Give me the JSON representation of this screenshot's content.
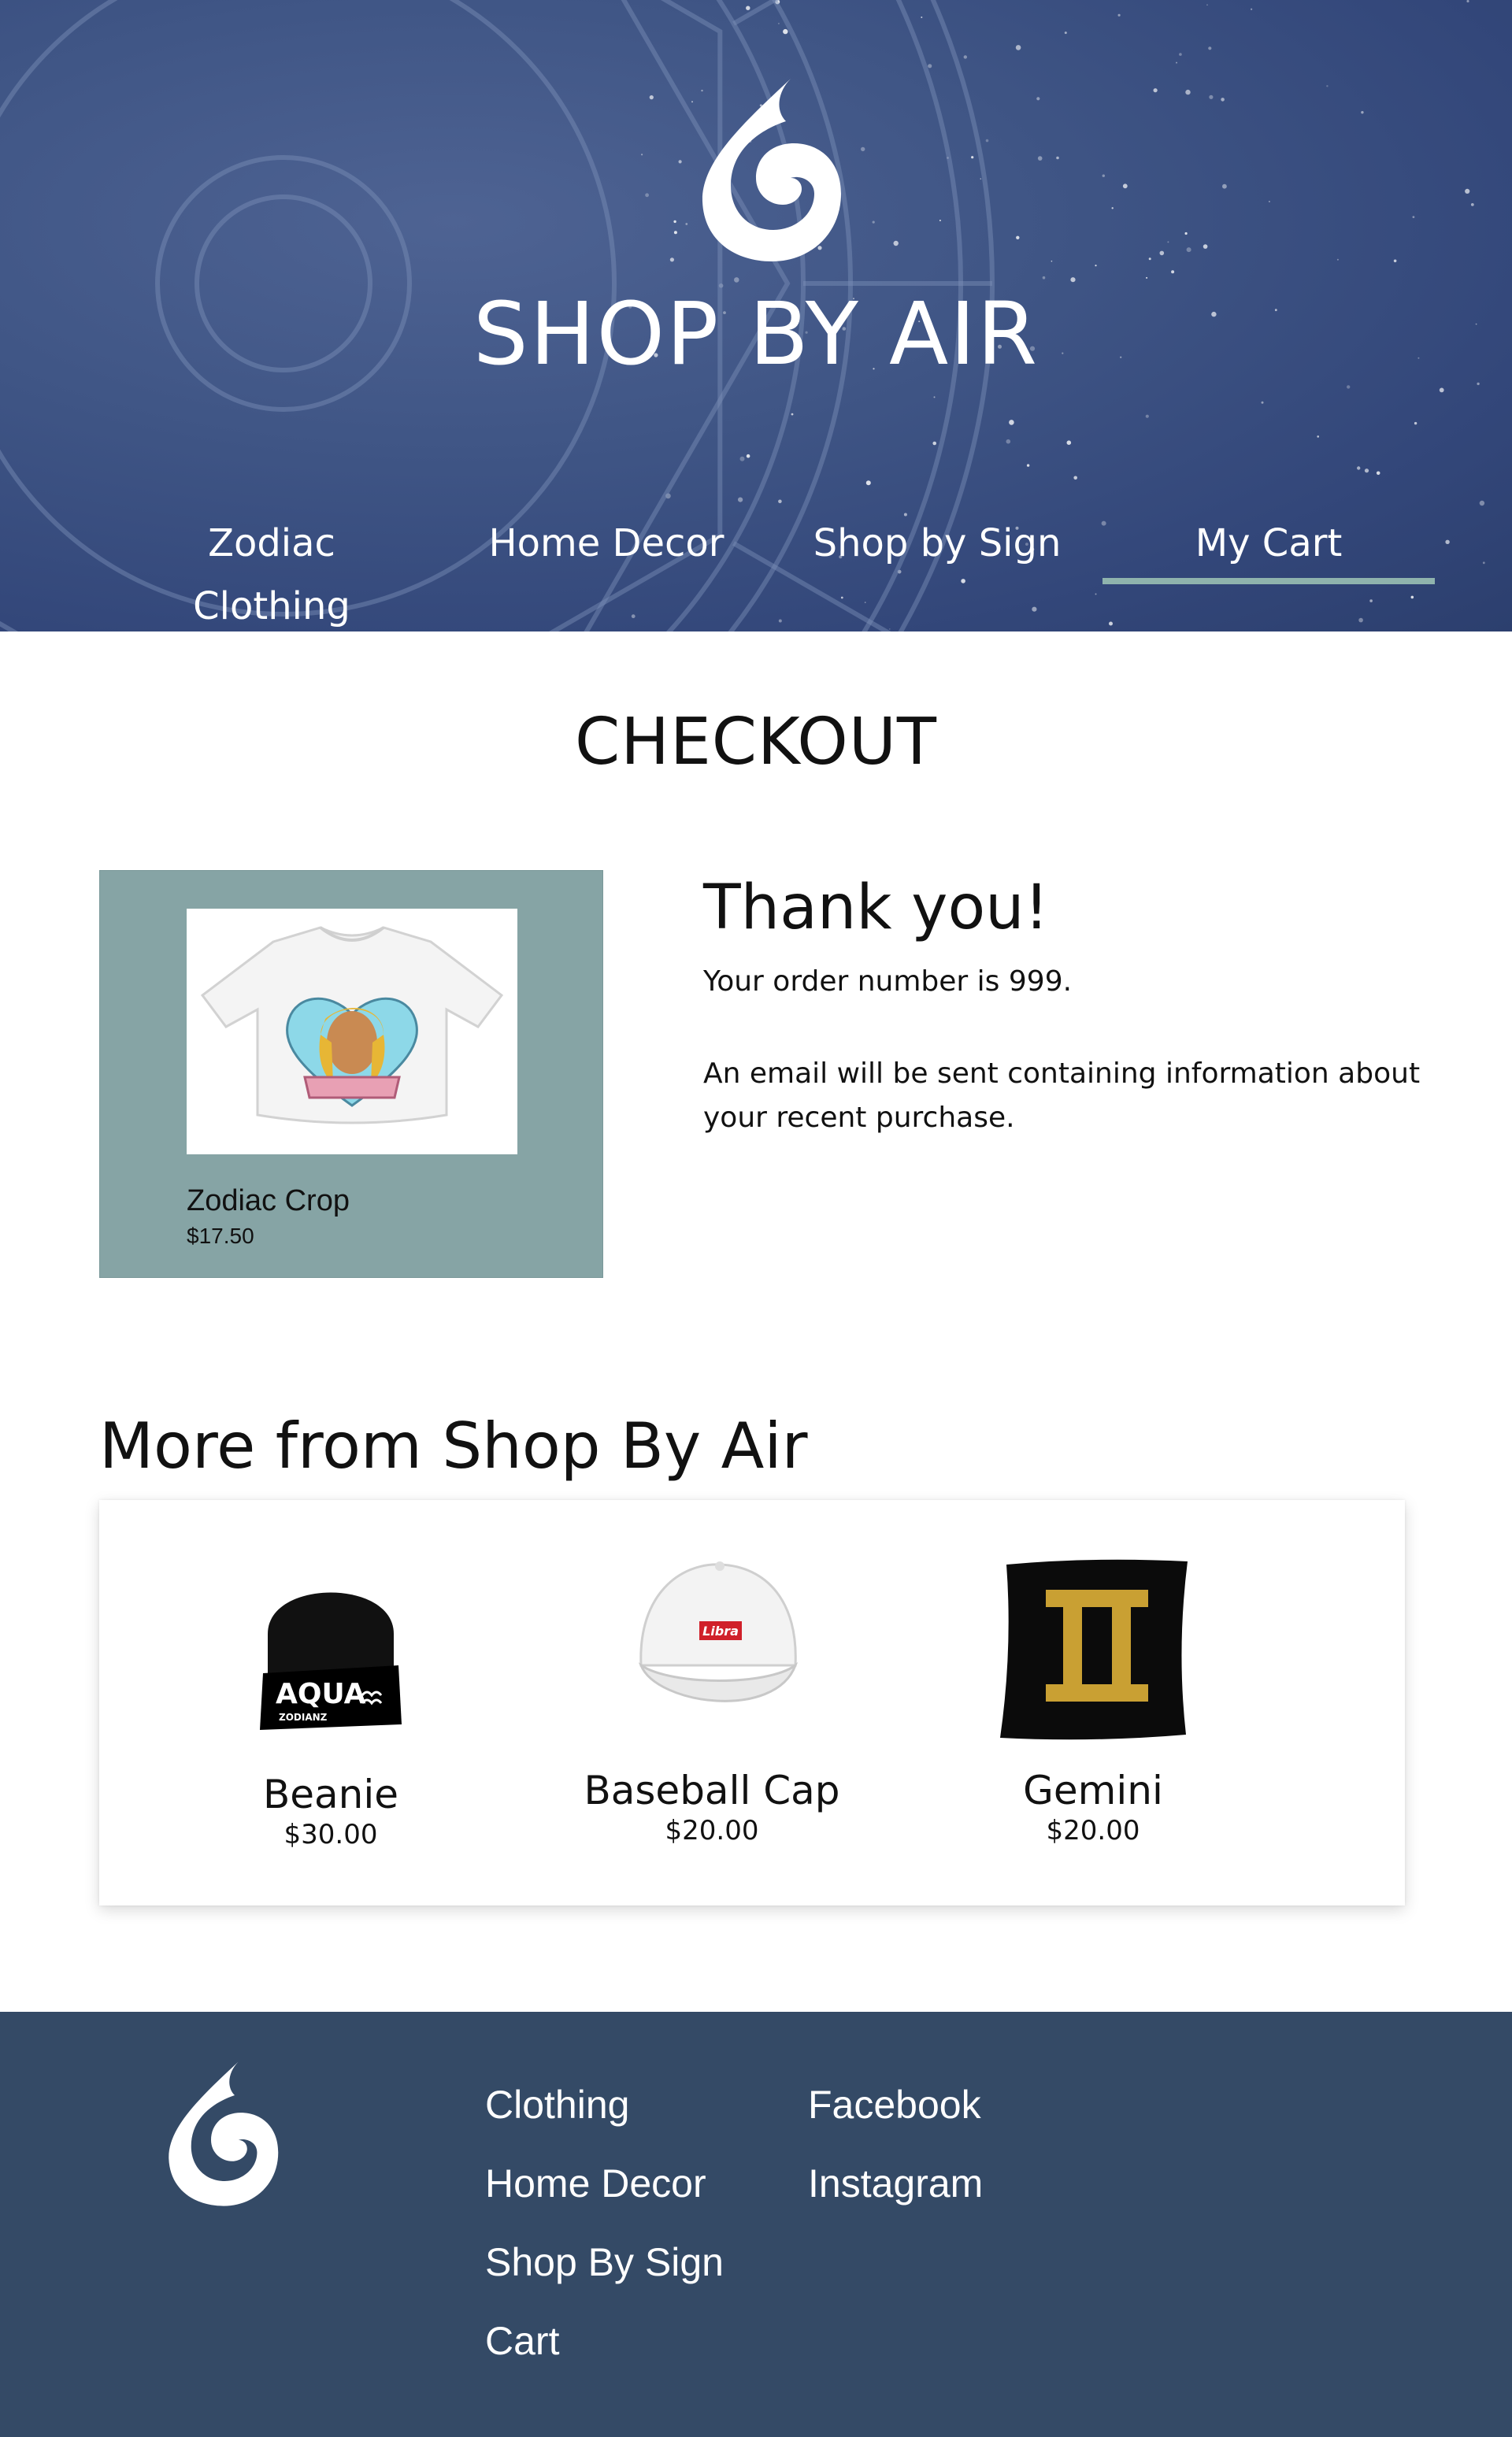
{
  "header": {
    "site_title": "SHOP BY AIR",
    "logo_icon": "air-drop-logo-icon",
    "nav": [
      {
        "label": "Zodiac Clothing",
        "active": false
      },
      {
        "label": "Home Decor",
        "active": false
      },
      {
        "label": "Shop by Sign",
        "active": false
      },
      {
        "label": "My Cart",
        "active": true
      }
    ],
    "active_underline_color": "#8fb3ad"
  },
  "checkout": {
    "title": "CHECKOUT",
    "order_item": {
      "name": "Zodiac Crop",
      "price": "$17.50",
      "card_color": "#86a4a5"
    },
    "thank_you": "Thank you!",
    "order_number_text": "Your order number is 999.",
    "email_text": "An email will be sent containing information about your recent purchase."
  },
  "more": {
    "heading": "More from Shop By Air",
    "products": [
      {
        "name": "Beanie",
        "price": "$30.00",
        "image_text": "AQUA",
        "image_subtext": "ZODIANZ"
      },
      {
        "name": "Baseball Cap",
        "price": "$20.00",
        "image_text": "Libra"
      },
      {
        "name": "Gemini",
        "price": "$20.00"
      }
    ]
  },
  "footer": {
    "logo_icon": "air-drop-logo-icon",
    "shop_links": [
      "Clothing",
      "Home Decor",
      "Shop By Sign",
      "Cart"
    ],
    "social_links": [
      "Facebook",
      "Instagram"
    ],
    "background_color": "#344a66"
  }
}
